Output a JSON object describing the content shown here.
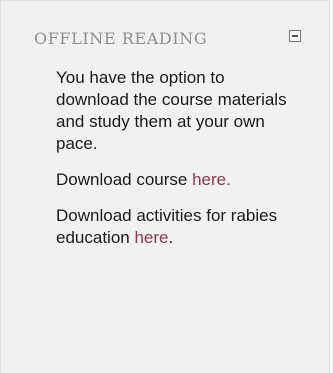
{
  "block": {
    "title": "OFFLINE READING",
    "collapse_icon": "minus-square-icon",
    "intro": "You have the option to download the course materials and study them at your own pace.",
    "course_prefix": "Download course ",
    "course_link": "here.",
    "activities_prefix": "Download activities for rabies education ",
    "activities_link": "here",
    "activities_suffix": ".",
    "link_color": "#8a3a4a",
    "title_color": "#8f8f8f"
  }
}
